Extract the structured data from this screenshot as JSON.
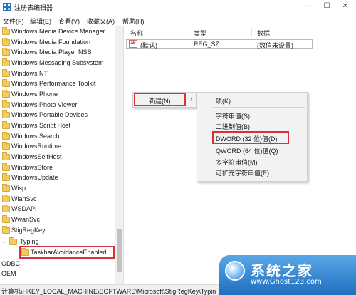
{
  "window": {
    "title": "注册表编辑器",
    "minimize": "—",
    "maximize": "☐",
    "close": "✕"
  },
  "menu": [
    "文件(F)",
    "编辑(E)",
    "查看(V)",
    "收藏夹(A)",
    "帮助(H)"
  ],
  "tree": {
    "items": [
      "Windows Media Device Manager",
      "Windows Media Foundation",
      "Windows Media Player NSS",
      "Windows Messaging Subsystem",
      "Windows NT",
      "Windows Performance Toolkit",
      "Windows Phone",
      "Windows Photo Viewer",
      "Windows Portable Devices",
      "Windows Script Host",
      "Windows Search",
      "WindowsRuntime",
      "WindowsSelfHost",
      "WindowsStore",
      "WindowsUpdate",
      "Wisp",
      "WlanSvc",
      "WSDAPI",
      "WwanSvc",
      "StigRegKey"
    ],
    "typing": "Typing",
    "selected": "TaskbarAvoidanceEnabled",
    "odbc": "ODBC",
    "oem": "OEM",
    "expand_glyph": "⌄"
  },
  "list": {
    "headers": [
      "名称",
      "类型",
      "数据"
    ],
    "row": {
      "icon": "ab",
      "name": "(默认)",
      "type": "REG_SZ",
      "data": "(数值未设置)"
    }
  },
  "context_menu": {
    "new_label": "新建(N)",
    "arrow": "›",
    "items": [
      "项(K)",
      "字符串值(S)",
      "二进制值(B)",
      "DWORD (32 位)值(D)",
      "QWORD (64 位)值(Q)",
      "多字符串值(M)",
      "可扩充字符串值(E)"
    ]
  },
  "status": "计算机\\HKEY_LOCAL_MACHINE\\SOFTWARE\\Microsoft\\StigRegKey\\Typin",
  "watermark": {
    "title": "系统之家",
    "url": "www.Ghost123.com"
  },
  "colors": {
    "highlight": "#d9313b",
    "folder": "#f4cc5c",
    "watermark": "#1f6fc0"
  }
}
